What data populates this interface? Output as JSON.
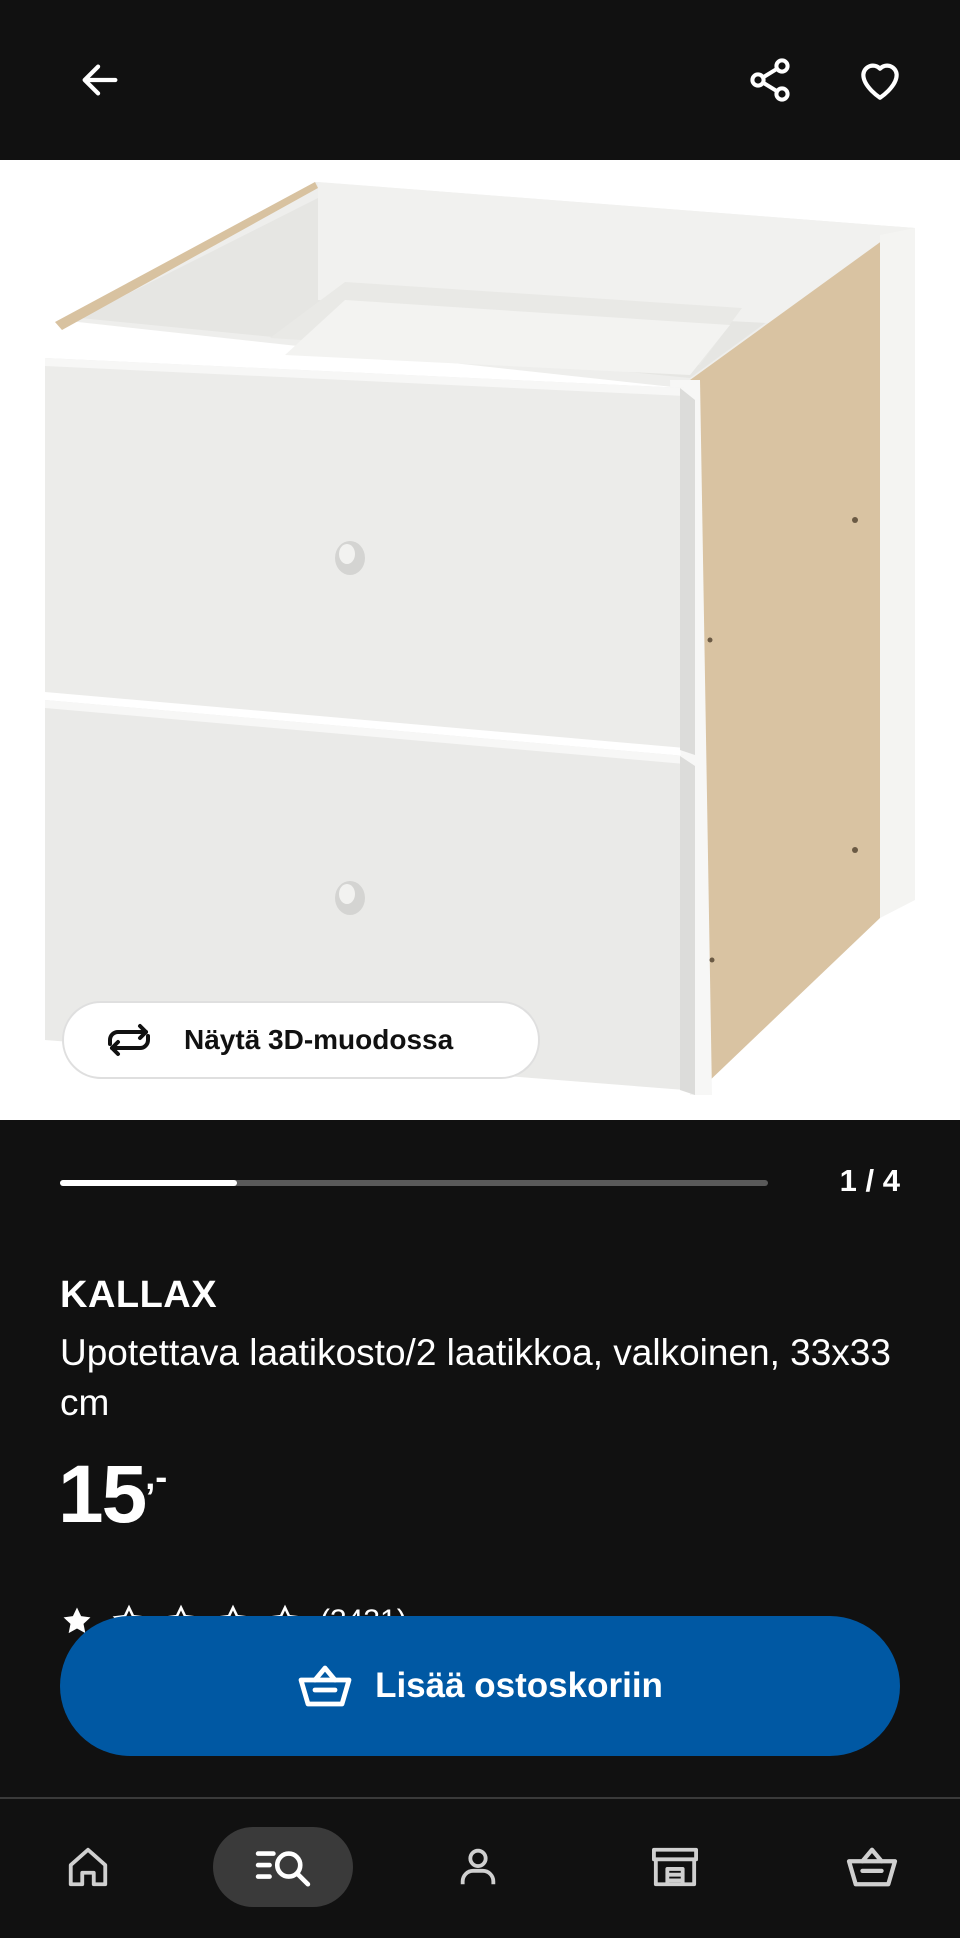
{
  "header": {
    "back_icon": "arrow-left-icon",
    "share_icon": "share-icon",
    "favourite_icon": "heart-icon"
  },
  "gallery": {
    "view_3d_label": "Näytä 3D-muodossa",
    "view_3d_icon": "rotate-3d-icon",
    "current_image": 1,
    "total_images": 4,
    "progress_fraction": 0.25,
    "counter_text": "1 / 4"
  },
  "product": {
    "brand": "KALLAX",
    "description": "Upotettava laatikosto/2 laatikkoa, valkoinen, 33x33 cm",
    "price_whole": "15",
    "price_suffix": ",-",
    "rating_stars": 5,
    "rating_filled": 1,
    "review_count": "(3431)"
  },
  "cart_button": {
    "label": "Lisää ostoskoriin",
    "icon": "shopping-basket-icon",
    "color": "#0058a3"
  },
  "bottom_nav": {
    "items": [
      {
        "name": "home",
        "icon": "home-icon"
      },
      {
        "name": "search",
        "icon": "search-list-icon",
        "active": true
      },
      {
        "name": "profile",
        "icon": "person-icon"
      },
      {
        "name": "stores",
        "icon": "store-icon"
      },
      {
        "name": "cart",
        "icon": "shopping-basket-icon"
      }
    ]
  }
}
